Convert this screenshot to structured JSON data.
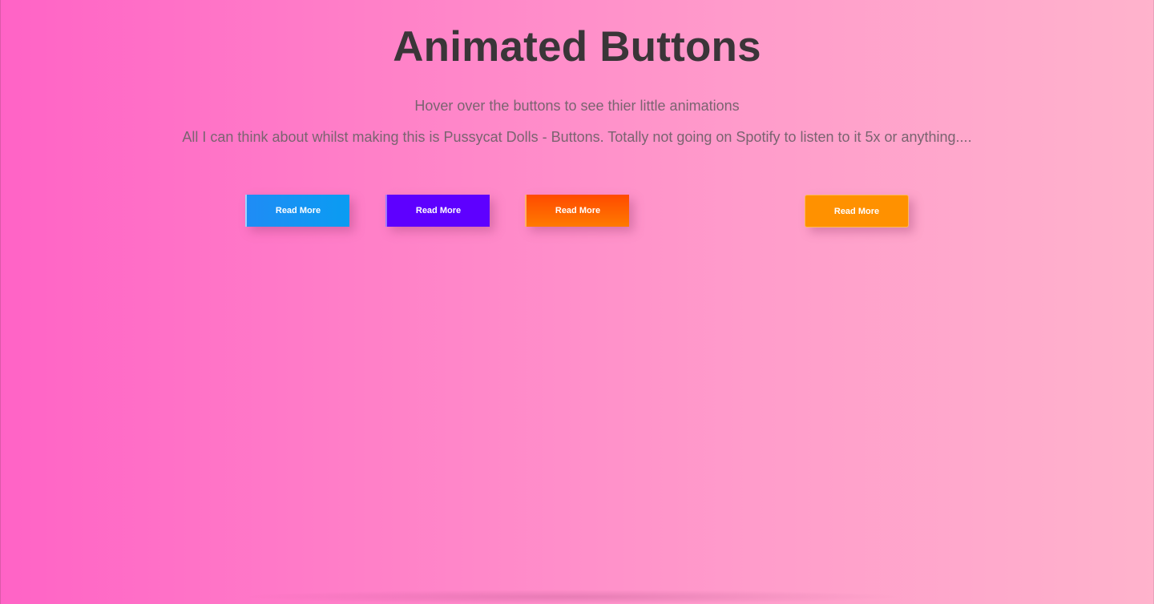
{
  "header": {
    "title": "Animated Buttons",
    "subtitle": "Hover over the buttons to see thier little animations",
    "description": "All I can think about whilst making this is Pussycat Dolls - Buttons. Totally not going on Spotify to listen to it 5x or anything...."
  },
  "buttons": [
    {
      "label": "Read More",
      "color": "#1f8cf5"
    },
    {
      "label": "Read More",
      "color": "#5e00ff"
    },
    {
      "label": "Read More",
      "color": "#ff4a00"
    },
    {
      "label": "Read More",
      "color": "#ff9100"
    }
  ],
  "theme": {
    "background_start": "#ff63c6",
    "background_end": "#ffb3cc",
    "title_color": "#3a3538",
    "text_color": "#7a6470"
  }
}
